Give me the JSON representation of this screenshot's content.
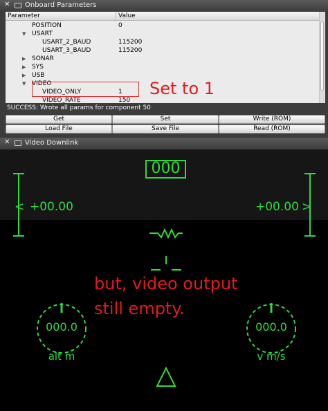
{
  "onboard": {
    "title": "Onboard Parameters",
    "col_param": "Parameter",
    "col_value": "Value",
    "rows": [
      {
        "name": "POSITION",
        "value": "0"
      },
      {
        "name": "USART",
        "value": ""
      },
      {
        "name": "USART_2_BAUD",
        "value": "115200"
      },
      {
        "name": "USART_3_BAUD",
        "value": "115200"
      },
      {
        "name": "SONAR",
        "value": ""
      },
      {
        "name": "SYS",
        "value": ""
      },
      {
        "name": "USB",
        "value": ""
      },
      {
        "name": "VIDEO",
        "value": ""
      },
      {
        "name": "VIDEO_ONLY",
        "value": "1"
      },
      {
        "name": "VIDEO_RATE",
        "value": "150"
      }
    ],
    "status": "SUCCESS: Wrote all params for component 50",
    "buttons": {
      "get": "Get",
      "set": "Set",
      "write_rom": "Write (ROM)",
      "load_file": "Load File",
      "save_file": "Save File",
      "read_rom": "Read (ROM)"
    }
  },
  "annotations": {
    "set_to_1": "Set to 1",
    "line1": "but, video output",
    "line2": "still empty."
  },
  "video": {
    "title": "Video Downlink",
    "heading": "000",
    "left_value": "+00.00",
    "right_value": "+00.00",
    "left_arrow": "<",
    "right_arrow": ">",
    "alt_value": "000.0",
    "alt_label": "alt m",
    "speed_value": "000.0",
    "speed_label": "v m/s"
  },
  "colors": {
    "hud_green": "#2fdc3f",
    "annotation_red": "#e21b1b",
    "video_background": "#000000"
  }
}
